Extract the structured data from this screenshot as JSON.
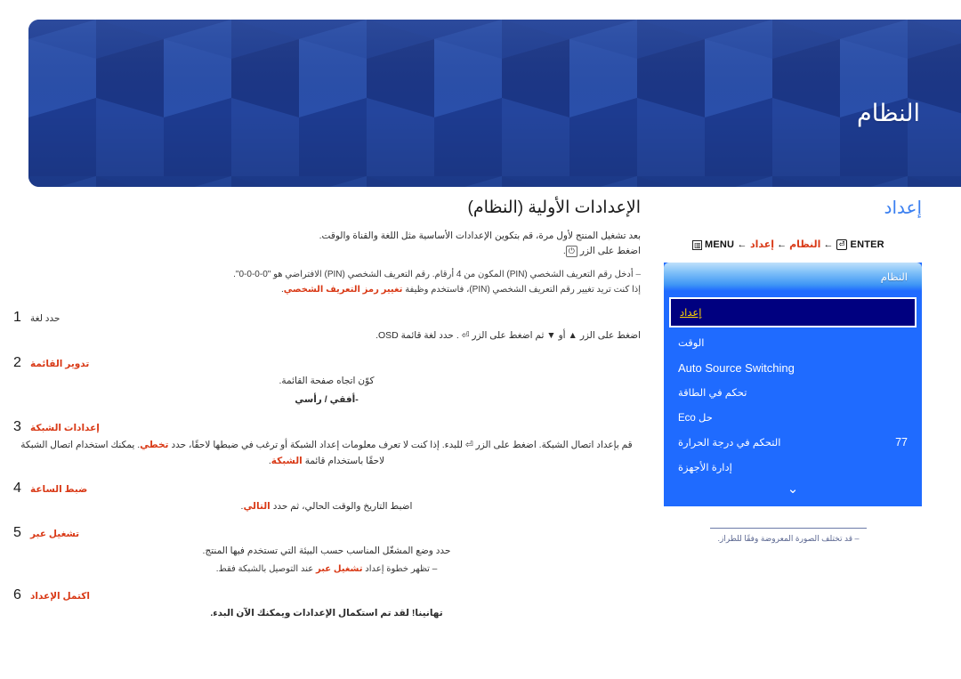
{
  "header": {
    "title": "النظام",
    "colors": {
      "base": "#1f3f96",
      "light": "#2a4faa",
      "dark": "#1b3686",
      "mid": "#23459e"
    }
  },
  "left": {
    "section_title": "الإعدادات الأولية (النظام)",
    "intro_line1": "بعد تشغيل المنتج لأول مرة، قم بتكوين الإعدادات الأساسية مثل اللغة والقناة والوقت.",
    "intro_line2_prefix": "اضغط على الزر",
    "intro_line2_key": "⏻",
    "intro_line2_suffix": ".",
    "note1_line1": "أدخل رقم التعريف الشخصي (PIN) المكون من 4 أرقام. رقم التعريف الشخصي (PIN) الافتراضي هو \"0-0-0-0\".",
    "note1_line2_a": "إذا كنت تريد تغيير رقم التعريف الشخصي (PIN)، فاستخدم وظيفة",
    "note1_line2_red": "تغيير رمز التعريف الشخصي",
    "note1_line2_b": ".",
    "steps": [
      {
        "num": "1",
        "label": "حدد لغة",
        "label_color": "plain",
        "body": "اضغط على الزر ▲ أو ▼ ثم اضغط على الزر ⏎ . حدد لغة قائمة OSD."
      },
      {
        "num": "2",
        "label": "تدوير القائمة",
        "label_color": "red",
        "body": "كوّن اتجاه صفحة القائمة.",
        "options": "-أفقي / رأسي"
      },
      {
        "num": "3",
        "label": "إعدادات الشبكة",
        "label_color": "red",
        "body_a": "قم بإعداد اتصال الشبكة. اضغط على الزر ⏎ للبدء. إذا كنت لا تعرف معلومات إعداد الشبكة أو ترغب في ضبطها لاحقًا، حدد",
        "body_red1": "تخطي",
        "body_b": ". يمكنك استخدام اتصال الشبكة لاحقًا باستخدام قائمة",
        "body_red2": "الشبكة",
        "body_c": "."
      },
      {
        "num": "4",
        "label": "ضبط الساعة",
        "label_color": "red",
        "body_a": "اضبط التاريخ والوقت الحالي، ثم حدد",
        "body_red": "التالي",
        "body_b": "."
      },
      {
        "num": "5",
        "label": "تشغيل عبر",
        "label_color": "red",
        "body": "حدد وضع المشغّل المناسب حسب البيئة التي تستخدم فيها المنتج.",
        "note_a": "تظهر خطوة إعداد",
        "note_red": "تشغيل عبر",
        "note_b": "عند التوصيل بالشبكة فقط."
      },
      {
        "num": "6",
        "label": "اكتمل الإعداد",
        "label_color": "red",
        "body": "تهانينا! لقد تم استكمال الإعدادات ويمكنك الآن البدء."
      }
    ]
  },
  "right": {
    "title": "إعداد",
    "breadcrumb": {
      "menu_word": "MENU",
      "menu_glyph": "▥",
      "arrow": "←",
      "crumb1": "النظام",
      "crumb2": "إعداد",
      "enter_word": "ENTER",
      "enter_glyph": "⏎"
    },
    "osd": {
      "header_label": "النظام",
      "rows": [
        {
          "label": "إعداد",
          "value": "",
          "selected": true,
          "latin": false
        },
        {
          "label": "الوقت",
          "value": "",
          "selected": false,
          "latin": false
        },
        {
          "label": "Auto Source Switching",
          "value": "",
          "selected": false,
          "latin": true
        },
        {
          "label": "تحكم في الطاقة",
          "value": "",
          "selected": false,
          "latin": false
        },
        {
          "label": "حل Eco",
          "value": "",
          "selected": false,
          "latin": false
        },
        {
          "label": "التحكم في درجة الحرارة",
          "value": "77",
          "selected": false,
          "latin": false
        },
        {
          "label": "إدارة الأجهزة",
          "value": "",
          "selected": false,
          "latin": false
        }
      ],
      "scroll_arrow": "⌄",
      "caption": "‒ قد تختلف الصورة المعروضة وفقًا للطراز."
    }
  },
  "colors": {
    "banner_blue": "#1f3f96",
    "accent_red": "#d93a17",
    "link_blue": "#3a7ff0",
    "osd_blue": "#1f6bff",
    "osd_selected": "#000080",
    "osd_selected_text": "#ffd400"
  }
}
